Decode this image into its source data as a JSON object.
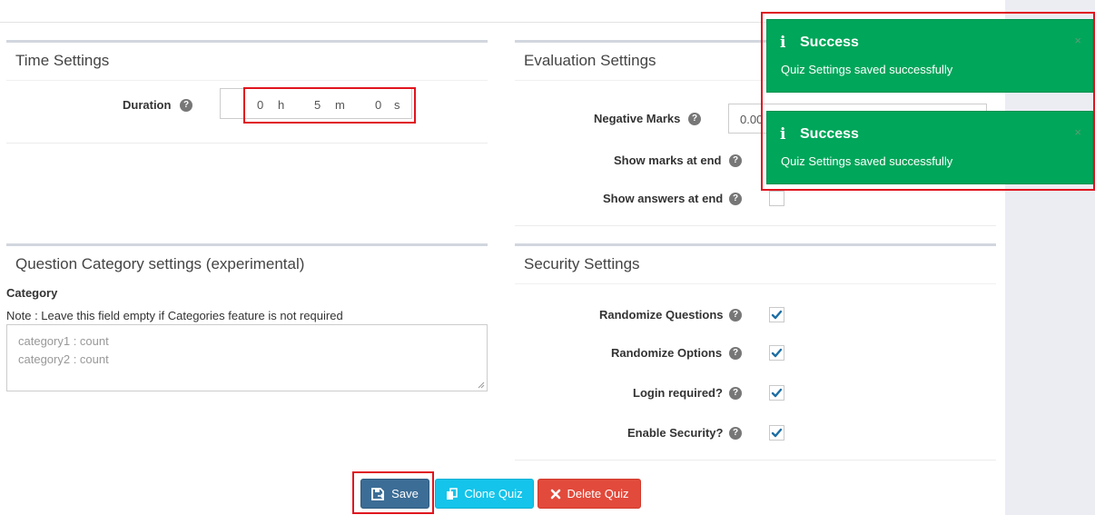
{
  "time_settings": {
    "title": "Time Settings",
    "duration_label": "Duration",
    "hours": "0",
    "hours_unit": "h",
    "minutes": "5",
    "minutes_unit": "m",
    "seconds": "0",
    "seconds_unit": "s"
  },
  "evaluation_settings": {
    "title": "Evaluation Settings",
    "negative_marks_label": "Negative Marks",
    "negative_marks_value": "0.00",
    "show_marks_label": "Show marks at end",
    "show_answers_label": "Show answers at end",
    "show_answers_checked": false
  },
  "category_settings": {
    "title": "Question Category settings (experimental)",
    "category_label": "Category",
    "note": "Note : Leave this field empty if Categories feature is not required",
    "placeholder_line1": "category1 : count",
    "placeholder_line2": "category2 : count"
  },
  "security_settings": {
    "title": "Security Settings",
    "randomize_questions_label": "Randomize Questions",
    "randomize_questions_checked": true,
    "randomize_options_label": "Randomize Options",
    "randomize_options_checked": true,
    "login_required_label": "Login required?",
    "login_required_checked": true,
    "enable_security_label": "Enable Security?",
    "enable_security_checked": true
  },
  "actions": {
    "save_label": "Save",
    "clone_label": "Clone Quiz",
    "delete_label": "Delete Quiz"
  },
  "toasts": [
    {
      "title": "Success",
      "message": "Quiz Settings saved successfully",
      "close": "×",
      "icon": "info-icon"
    },
    {
      "title": "Success",
      "message": "Quiz Settings saved successfully",
      "close": "×",
      "icon": "info-icon"
    }
  ],
  "colors": {
    "success": "#00a65a",
    "primary": "#3c6d96",
    "info": "#14c4ea",
    "danger": "#e24a3b",
    "highlight": "#e0141e",
    "checkbox_check": "#1c6ea4"
  },
  "help_icon_glyph": "?",
  "toast_icon_glyph": "i"
}
